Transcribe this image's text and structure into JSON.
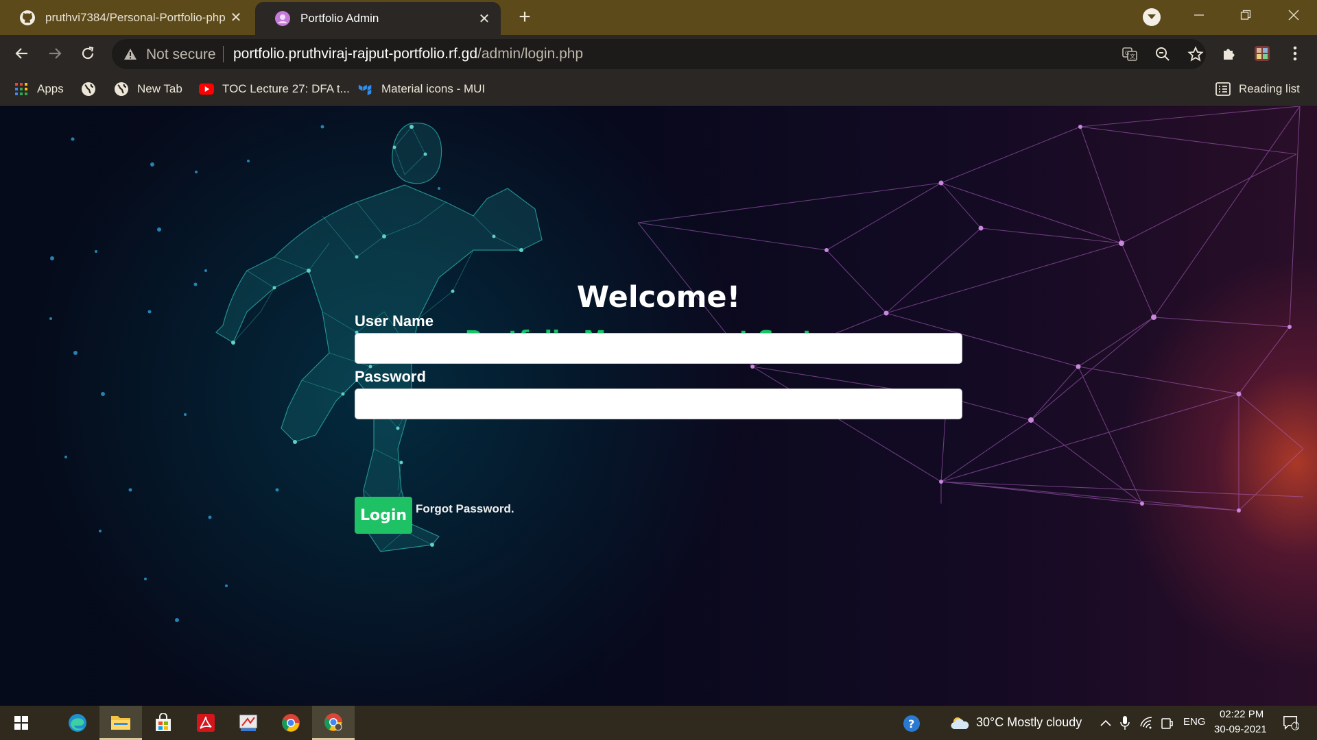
{
  "browser": {
    "tabs": [
      {
        "title": "pruthvi7384/Personal-Portfolio-php",
        "icon": "github-icon",
        "active": false
      },
      {
        "title": "Portfolio Admin",
        "icon": "portfolio-favicon",
        "active": true
      }
    ],
    "address_bar": {
      "security_label": "Not secure",
      "url_domain": "portfolio.pruthviraj-rajput-portfolio.rf.gd",
      "url_path": "/admin/login.php"
    },
    "bookmarks": [
      {
        "label": "Apps",
        "icon": "apps-grid-icon"
      },
      {
        "label": "",
        "icon": "globe-icon"
      },
      {
        "label": "New Tab",
        "icon": "globe-icon"
      },
      {
        "label": "TOC Lecture 27: DFA t...",
        "icon": "youtube-icon"
      },
      {
        "label": "Material icons - MUI",
        "icon": "mui-icon"
      }
    ],
    "reading_list": "Reading list"
  },
  "page": {
    "welcome": "Welcome!",
    "subtitle": "Portfolio Management System",
    "username_label": "User Name",
    "password_label": "Password",
    "username_value": "",
    "password_value": "",
    "login_button": "Login",
    "forgot_link": "Forgot Password."
  },
  "taskbar": {
    "apps": [
      "windows-start-icon",
      "edge-icon",
      "file-explorer-icon",
      "store-icon",
      "acrobat-icon",
      "snipping-tool-icon",
      "chrome-icon",
      "chrome-active-icon"
    ],
    "weather": "30°C  Mostly cloudy",
    "language": "ENG",
    "time": "02:22 PM",
    "date": "30-09-2021",
    "notification_count": "1"
  },
  "colors": {
    "tab_strip": "#5c4a1a",
    "toolbar": "#2a2724",
    "accent_green": "#16c466",
    "button_green": "#1ec264",
    "taskbar": "#2f2a1d"
  }
}
